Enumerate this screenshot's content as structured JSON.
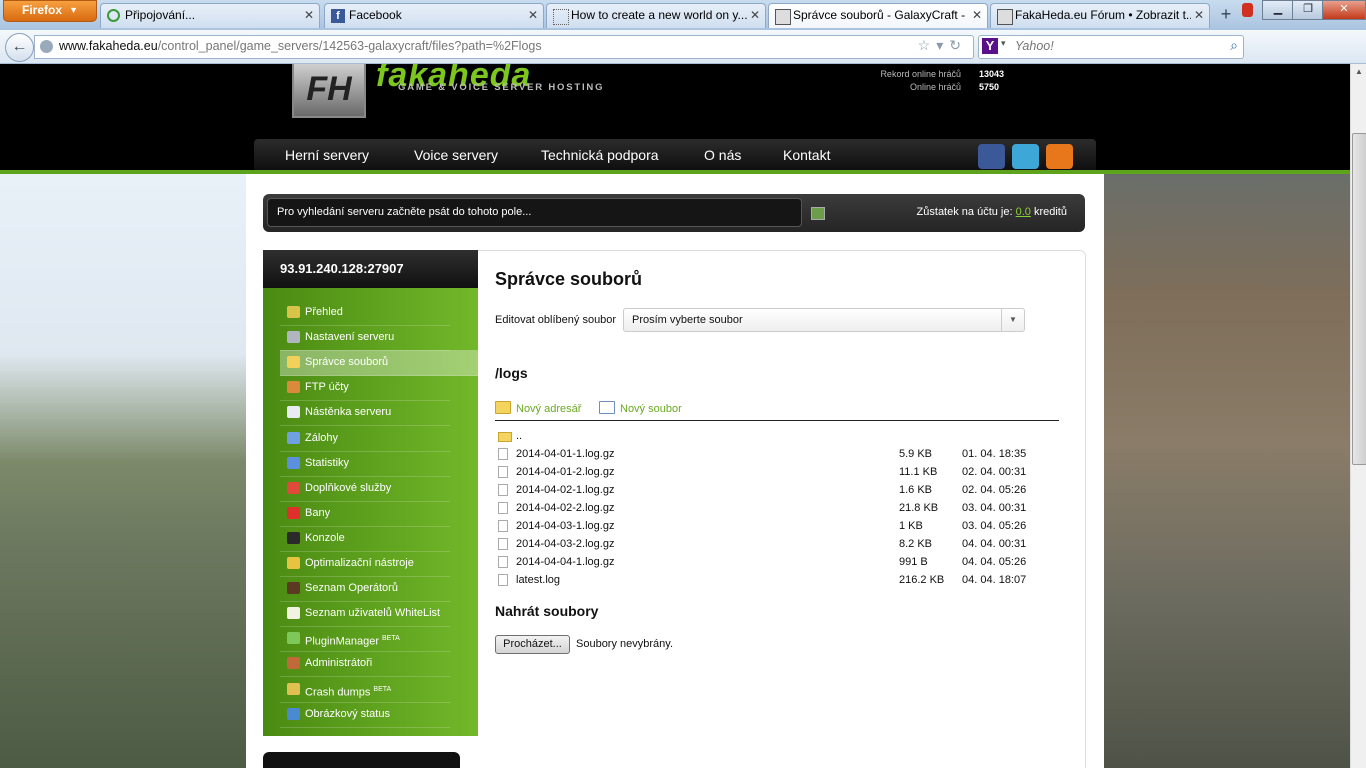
{
  "browser": {
    "menu_button": "Firefox",
    "tabs": [
      {
        "label": "Připojování...",
        "active": false
      },
      {
        "label": "Facebook",
        "active": false
      },
      {
        "label": "How to create a new world on y...",
        "active": false
      },
      {
        "label": "Správce souborů - GalaxyCraft - ...",
        "active": true
      },
      {
        "label": "FakaHeda.eu Fórum • Zobrazit t...",
        "active": false
      }
    ],
    "new_tab": "+",
    "url_domain": "www.fakaheda.eu",
    "url_path": "/control_panel/game_servers/142563-galaxycraft/files?path=%2Flogs",
    "search_placeholder": "Yahoo!"
  },
  "header": {
    "logo_letters": "FH",
    "logo_text": "fakaheda",
    "logo_subtitle": "GAME & VOICE SERVER HOSTING",
    "stats": [
      {
        "label": "Rekord online hráčů",
        "value": "13043"
      },
      {
        "label": "Online hráčů",
        "value": "5750"
      }
    ],
    "menu": [
      "Herní servery",
      "Voice servery",
      "Technická podpora",
      "O nás",
      "Kontakt"
    ]
  },
  "topbar": {
    "search_placeholder": "Pro vyhledání serveru začněte psát do tohoto pole...",
    "balance_prefix": "Zůstatek na účtu je:",
    "balance_amount": "0.0",
    "balance_suffix": "kreditů"
  },
  "sidebar": {
    "server_address": "93.91.240.128:27907",
    "items": [
      {
        "label": "Přehled",
        "icon": "magnifier-icon",
        "color": "#d9c44a"
      },
      {
        "label": "Nastavení serveru",
        "icon": "wrench-icon",
        "color": "#b0b6c0"
      },
      {
        "label": "Správce souborů",
        "icon": "folder-icon",
        "color": "#f1d15a",
        "active": true
      },
      {
        "label": "FTP účty",
        "icon": "users-icon",
        "color": "#d98a3a"
      },
      {
        "label": "Nástěnka serveru",
        "icon": "board-icon",
        "color": "#e8ecf2"
      },
      {
        "label": "Zálohy",
        "icon": "disc-icon",
        "color": "#6fa0e0"
      },
      {
        "label": "Statistiky",
        "icon": "chart-icon",
        "color": "#5b8fe0"
      },
      {
        "label": "Doplňkové služby",
        "icon": "gift-icon",
        "color": "#e04a3a"
      },
      {
        "label": "Bany",
        "icon": "cross-icon",
        "color": "#e0302a"
      },
      {
        "label": "Konzole",
        "icon": "console-icon",
        "color": "#2a2a2a"
      },
      {
        "label": "Optimalizační nástroje",
        "icon": "tools-icon",
        "color": "#e6c440"
      },
      {
        "label": "Seznam Operátorů",
        "icon": "operator-icon",
        "color": "#5a3a20"
      },
      {
        "label": "Seznam uživatelů WhiteList",
        "icon": "list-icon",
        "color": "#f2f2e0"
      },
      {
        "label": "PluginManager",
        "icon": "plugin-icon",
        "color": "#7ec85a",
        "badge": "BETA"
      },
      {
        "label": "Administrátoři",
        "icon": "admin-icon",
        "color": "#c06a3a"
      },
      {
        "label": "Crash dumps",
        "icon": "gear-icon",
        "color": "#e0c050",
        "badge": "BETA"
      },
      {
        "label": "Obrázkový status",
        "icon": "image-icon",
        "color": "#4a8ad0"
      }
    ]
  },
  "main": {
    "title": "Správce souborů",
    "favorite_label": "Editovat oblíbený soubor",
    "favorite_select": "Prosím vyberte soubor",
    "path": "/logs",
    "new_folder": "Nový adresář",
    "new_file": "Nový soubor",
    "files": [
      {
        "name": "..",
        "size": "",
        "date": "",
        "type": "folder"
      },
      {
        "name": "2014-04-01-1.log.gz",
        "size": "5.9 KB",
        "date": "01. 04. 18:35",
        "type": "file"
      },
      {
        "name": "2014-04-01-2.log.gz",
        "size": "11.1 KB",
        "date": "02. 04. 00:31",
        "type": "file"
      },
      {
        "name": "2014-04-02-1.log.gz",
        "size": "1.6 KB",
        "date": "02. 04. 05:26",
        "type": "file"
      },
      {
        "name": "2014-04-02-2.log.gz",
        "size": "21.8 KB",
        "date": "03. 04. 00:31",
        "type": "file"
      },
      {
        "name": "2014-04-03-1.log.gz",
        "size": "1 KB",
        "date": "03. 04. 05:26",
        "type": "file"
      },
      {
        "name": "2014-04-03-2.log.gz",
        "size": "8.2 KB",
        "date": "04. 04. 00:31",
        "type": "file"
      },
      {
        "name": "2014-04-04-1.log.gz",
        "size": "991 B",
        "date": "04. 04. 05:26",
        "type": "file"
      },
      {
        "name": "latest.log",
        "size": "216.2 KB",
        "date": "04. 04. 18:07",
        "type": "file"
      }
    ],
    "upload_title": "Nahrát soubory",
    "browse_button": "Procházet...",
    "no_file_text": "Soubory nevybrány."
  }
}
